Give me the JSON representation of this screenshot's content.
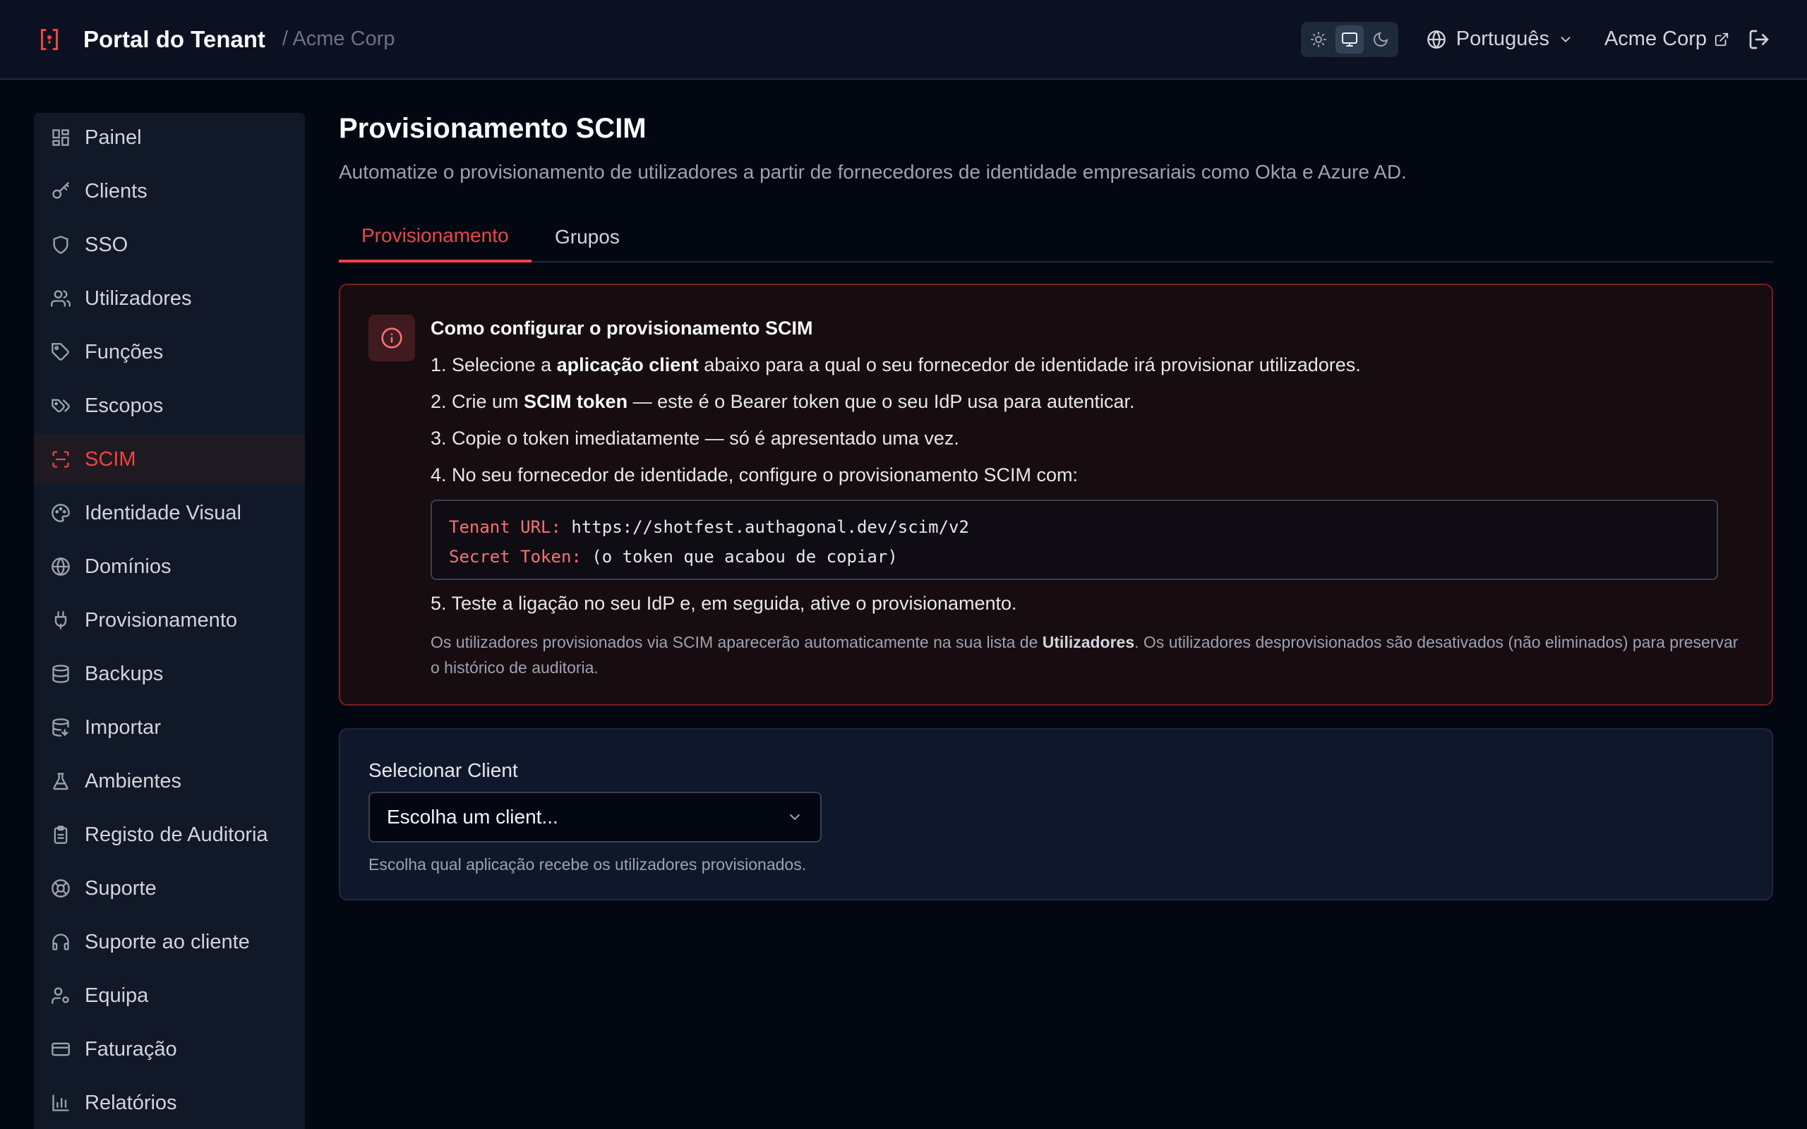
{
  "header": {
    "title": "Portal do Tenant",
    "breadcrumb": "/ Acme Corp",
    "theme_options": [
      "light-icon",
      "system-icon",
      "dark-icon"
    ],
    "theme_active": "system",
    "language": "Português",
    "org_name": "Acme Corp"
  },
  "sidebar": {
    "items": [
      {
        "label": "Painel",
        "icon": "dashboard-icon"
      },
      {
        "label": "Clients",
        "icon": "key-icon"
      },
      {
        "label": "SSO",
        "icon": "shield-icon"
      },
      {
        "label": "Utilizadores",
        "icon": "users-icon"
      },
      {
        "label": "Funções",
        "icon": "tag-icon"
      },
      {
        "label": "Escopos",
        "icon": "tags-icon"
      },
      {
        "label": "SCIM",
        "icon": "scan-icon",
        "active": true
      },
      {
        "label": "Identidade Visual",
        "icon": "palette-icon"
      },
      {
        "label": "Domínios",
        "icon": "globe-icon"
      },
      {
        "label": "Provisionamento",
        "icon": "plug-icon"
      },
      {
        "label": "Backups",
        "icon": "database-icon"
      },
      {
        "label": "Importar",
        "icon": "database-import-icon"
      },
      {
        "label": "Ambientes",
        "icon": "flask-icon"
      },
      {
        "label": "Registo de Auditoria",
        "icon": "clipboard-icon"
      },
      {
        "label": "Suporte",
        "icon": "lifebuoy-icon"
      },
      {
        "label": "Suporte ao cliente",
        "icon": "headset-icon"
      },
      {
        "label": "Equipa",
        "icon": "user-cog-icon"
      },
      {
        "label": "Faturação",
        "icon": "credit-card-icon"
      },
      {
        "label": "Relatórios",
        "icon": "bar-chart-icon"
      }
    ]
  },
  "main": {
    "title": "Provisionamento SCIM",
    "subtitle": "Automatize o provisionamento de utilizadores a partir de fornecedores de identidade empresariais como Okta e Azure AD.",
    "tabs": [
      {
        "label": "Provisionamento",
        "active": true
      },
      {
        "label": "Grupos",
        "active": false
      }
    ],
    "guide": {
      "title": "Como configurar o provisionamento SCIM",
      "step1": {
        "pre": "1. Selecione a ",
        "bold": "aplicação client",
        "post": " abaixo para a qual o seu fornecedor de identidade irá provisionar utilizadores."
      },
      "step2": {
        "pre": "2. Crie um ",
        "bold": "SCIM token",
        "post": " — este é o Bearer token que o seu IdP usa para autenticar."
      },
      "step3": "3. Copie o token imediatamente — só é apresentado uma vez.",
      "step4": "4. No seu fornecedor de identidade, configure o provisionamento SCIM com:",
      "code": {
        "url_key": "Tenant URL:",
        "url_val": "https://shotfest.authagonal.dev/scim/v2",
        "token_key": "Secret Token:",
        "token_val": "(o token que acabou de copiar)"
      },
      "step5": "5. Teste a ligação no seu IdP e, em seguida, ative o provisionamento.",
      "note": {
        "pre": "Os utilizadores provisionados via SCIM aparecerão automaticamente na sua lista de ",
        "bold": "Utilizadores",
        "post": ". Os utilizadores desprovisionados são desativados (não eliminados) para preservar o histórico de auditoria."
      }
    },
    "client_select": {
      "label": "Selecionar Client",
      "value": "Escolha um client...",
      "help": "Escolha qual aplicação recebe os utilizadores provisionados."
    }
  },
  "colors": {
    "accent": "#ef4444",
    "background": "#030712",
    "sidebar": "#111827",
    "info_border": "#7f1d1d"
  }
}
